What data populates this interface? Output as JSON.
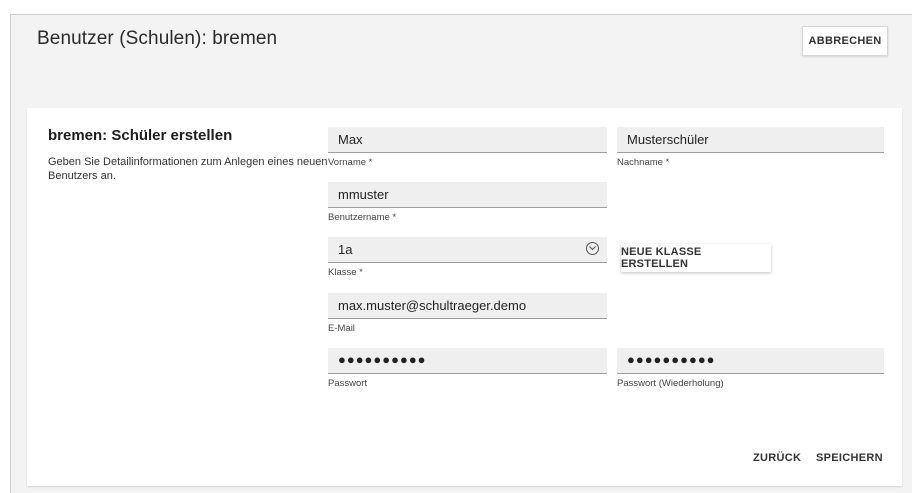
{
  "header": {
    "title": "Benutzer (Schulen): bremen",
    "cancel_label": "ABBRECHEN"
  },
  "card": {
    "title": "bremen: Schüler erstellen",
    "description": "Geben Sie Detailinformationen zum Anlegen eines neuen Benutzers an."
  },
  "form": {
    "firstname": {
      "value": "Max",
      "label": "Vorname *"
    },
    "lastname": {
      "value": "Musterschüler",
      "label": "Nachname *"
    },
    "username": {
      "value": "mmuster",
      "label": "Benutzername *"
    },
    "class": {
      "value": "1a",
      "label": "Klasse *",
      "icon": "chevron-down-circle-icon"
    },
    "new_class_button": "NEUE KLASSE ERSTELLEN",
    "email": {
      "value": "max.muster@schultraeger.demo",
      "label": "E-Mail"
    },
    "password": {
      "value": "●●●●●●●●●●",
      "label": "Passwort"
    },
    "password_repeat": {
      "value": "●●●●●●●●●●",
      "label": "Passwort (Wiederholung)"
    }
  },
  "footer": {
    "back_label": "ZURÜCK",
    "save_label": "SPEICHERN"
  },
  "colors": {
    "background": "#f3f3f3",
    "card": "#ffffff",
    "field": "#efefef"
  }
}
